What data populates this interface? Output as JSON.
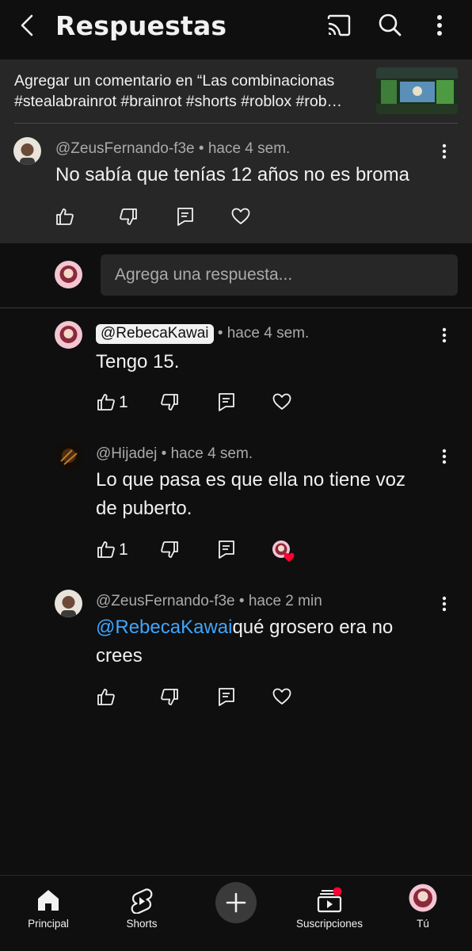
{
  "header": {
    "title": "Respuestas",
    "icons": [
      "back-icon",
      "cast-icon",
      "search-icon",
      "more-vertical-icon"
    ]
  },
  "context": {
    "line1": "Agregar un comentario en “Las combinacionas",
    "line2": "#stealabrainrot #brainrot #shorts #roblox #rob…"
  },
  "parent_comment": {
    "author": "@ZeusFernando-f3e",
    "time": "• hace 4 sem.",
    "text": "No sabía que tenías 12 años no es broma"
  },
  "reply_box": {
    "placeholder": "Agrega una respuesta..."
  },
  "replies": [
    {
      "author": "@RebecaKawai",
      "time": "• hace 4 sem.",
      "text": "Tengo 15.",
      "likes": "1"
    },
    {
      "author": "@Hijadej",
      "time": "• hace 4 sem.",
      "text_line1": "Lo que pasa es que ella no tiene voz",
      "text_line2": "de puberto.",
      "likes": "1"
    },
    {
      "author": "@ZeusFernando-f3e",
      "time": "• hace 2 min",
      "mention": "@RebecaKawai",
      "text_line1": "qué grosero era no",
      "text_line2": "crees"
    }
  ],
  "nav": {
    "items": [
      "Principal",
      "Shorts",
      "Suscripciones",
      "Tú"
    ]
  },
  "colors": {
    "background": "#0f0f0f",
    "surface": "#272727",
    "mention": "#3ea6ff",
    "heart": "#ff0033"
  }
}
